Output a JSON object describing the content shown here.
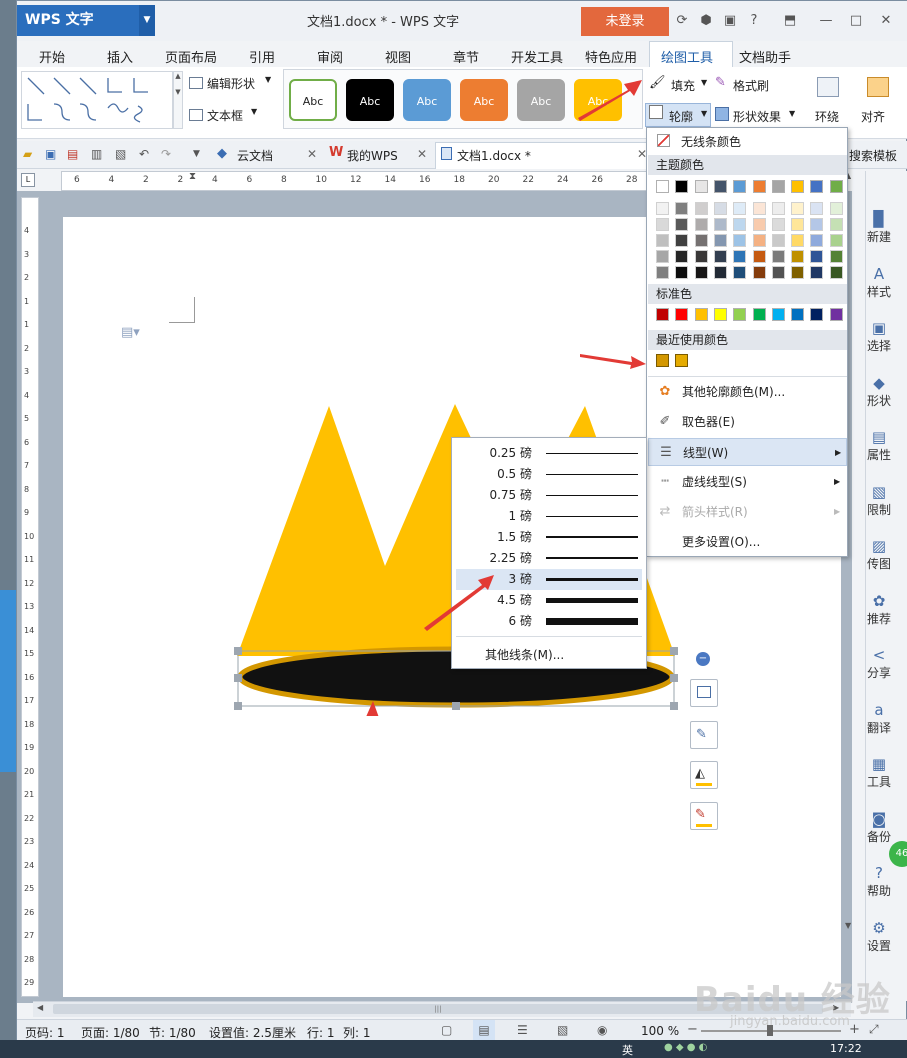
{
  "app": {
    "logo": "WPS 文字",
    "title": "文档1.docx * - WPS 文字",
    "login": "未登录"
  },
  "menu": [
    "开始",
    "插入",
    "页面布局",
    "引用",
    "审阅",
    "视图",
    "章节",
    "开发工具",
    "特色应用",
    "绘图工具",
    "文档助手"
  ],
  "ribbon": {
    "edit_shape": "编辑形状",
    "textbox": "文本框",
    "style_samples": [
      {
        "label": "Abc",
        "bg": "#ffffff",
        "border": "#70ad47",
        "color": "#222222"
      },
      {
        "label": "Abc",
        "bg": "#000000",
        "border": "#000000",
        "color": "#ffffff"
      },
      {
        "label": "Abc",
        "bg": "#5b9bd5",
        "border": "#5b9bd5",
        "color": "#ffffff"
      },
      {
        "label": "Abc",
        "bg": "#ed7d31",
        "border": "#ed7d31",
        "color": "#ffffff"
      },
      {
        "label": "Abc",
        "bg": "#a5a5a5",
        "border": "#a5a5a5",
        "color": "#ffffff"
      },
      {
        "label": "Abc",
        "bg": "#ffc000",
        "border": "#ffc000",
        "color": "#ffffff"
      }
    ],
    "fill": "填充",
    "format_painter": "格式刷",
    "outline": "轮廓",
    "shape_effects": "形状效果",
    "wrap": "环绕",
    "align": "对齐"
  },
  "tabs": {
    "cloud": "云文档",
    "mywps": "我的WPS",
    "doc": "文档1.docx *",
    "search_template": "搜索模板"
  },
  "ruler_ticks": [
    "6",
    "4",
    "2",
    "2",
    "4",
    "6",
    "8",
    "10",
    "12",
    "14",
    "16",
    "18",
    "20",
    "22",
    "24",
    "26",
    "28"
  ],
  "vruler_ticks": [
    "4",
    "3",
    "2",
    "1",
    "1",
    "2",
    "3",
    "4",
    "5",
    "6",
    "7",
    "8",
    "9",
    "10",
    "11",
    "12",
    "13",
    "14",
    "15",
    "16",
    "17",
    "18",
    "19",
    "20",
    "21",
    "22",
    "23",
    "24",
    "25",
    "26",
    "27",
    "28",
    "29"
  ],
  "outline_menu": {
    "no_line": "无线条颜色",
    "theme_colors": "主题颜色",
    "theme_top": [
      "#ffffff",
      "#000000",
      "#e7e6e6",
      "#44546a",
      "#5b9bd5",
      "#ed7d31",
      "#a5a5a5",
      "#ffc000",
      "#4472c4",
      "#70ad47"
    ],
    "theme_shades": [
      [
        "#f2f2f2",
        "#7f7f7f",
        "#d0cece",
        "#d6dce5",
        "#deebf7",
        "#fbe5d6",
        "#ededed",
        "#fff2cc",
        "#dae3f3",
        "#e2f0d9"
      ],
      [
        "#d9d9d9",
        "#595959",
        "#aeabab",
        "#adb9ca",
        "#bdd7ee",
        "#f8cbad",
        "#dbdbdb",
        "#ffe699",
        "#b4c7e7",
        "#c5e0b4"
      ],
      [
        "#bfbfbf",
        "#404040",
        "#757171",
        "#8497b0",
        "#9dc3e6",
        "#f4b183",
        "#c9c9c9",
        "#ffd966",
        "#8faadc",
        "#a9d18e"
      ],
      [
        "#a6a6a6",
        "#262626",
        "#3a3838",
        "#333f50",
        "#2e75b6",
        "#c55a11",
        "#7b7b7b",
        "#bf9000",
        "#2f5597",
        "#548235"
      ],
      [
        "#7f7f7f",
        "#0d0d0d",
        "#171616",
        "#222a35",
        "#1f4e79",
        "#843c0c",
        "#525252",
        "#7f6000",
        "#203864",
        "#385723"
      ]
    ],
    "standard_colors": "标准色",
    "standard": [
      "#c00000",
      "#ff0000",
      "#ffc000",
      "#ffff00",
      "#92d050",
      "#00b050",
      "#00b0f0",
      "#0070c0",
      "#002060",
      "#7030a0"
    ],
    "recent_colors": "最近使用颜色",
    "recent": [
      "#d39700",
      "#e5ab00"
    ],
    "more_colors": "其他轮廓颜色(M)...",
    "eyedropper": "取色器(E)",
    "line_type": "线型(W)",
    "dash_type": "虚线线型(S)",
    "arrow_style": "箭头样式(R)",
    "more_settings": "更多设置(O)..."
  },
  "weight_menu": {
    "items": [
      {
        "label": "0.25 磅",
        "weight": 0.25
      },
      {
        "label": "0.5 磅",
        "weight": 0.5
      },
      {
        "label": "0.75 磅",
        "weight": 0.75
      },
      {
        "label": "1 磅",
        "weight": 1
      },
      {
        "label": "1.5 磅",
        "weight": 1.5
      },
      {
        "label": "2.25 磅",
        "weight": 2.25
      },
      {
        "label": "3 磅",
        "weight": 3
      },
      {
        "label": "4.5 磅",
        "weight": 4.5
      },
      {
        "label": "6 磅",
        "weight": 6
      }
    ],
    "selected": "3 磅",
    "more": "其他线条(M)..."
  },
  "right_panel": [
    {
      "icon": "new-icon",
      "glyph": "▉",
      "label": "新建"
    },
    {
      "icon": "style-icon",
      "glyph": "A",
      "label": "样式"
    },
    {
      "icon": "select-icon",
      "glyph": "▣",
      "label": "选择"
    },
    {
      "icon": "shape-icon",
      "glyph": "◆",
      "label": "形状"
    },
    {
      "icon": "property-icon",
      "glyph": "▤",
      "label": "属性"
    },
    {
      "icon": "limit-icon",
      "glyph": "▧",
      "label": "限制"
    },
    {
      "icon": "image-icon",
      "glyph": "▨",
      "label": "传图"
    },
    {
      "icon": "recommend-icon",
      "glyph": "✿",
      "label": "推荐"
    },
    {
      "icon": "share-icon",
      "glyph": "<",
      "label": "分享"
    },
    {
      "icon": "translate-icon",
      "glyph": "a",
      "label": "翻译"
    },
    {
      "icon": "tools-icon",
      "glyph": "▦",
      "label": "工具"
    },
    {
      "icon": "backup-icon",
      "glyph": "◙",
      "label": "备份"
    },
    {
      "icon": "help-icon",
      "glyph": "?",
      "label": "帮助"
    },
    {
      "icon": "settings-icon",
      "glyph": "⚙",
      "label": "设置"
    }
  ],
  "float_badge": "46",
  "status": {
    "page_code": "页码: 1",
    "page": "页面: 1/80",
    "section": "节: 1/80",
    "setting": "设置值: 2.5厘米",
    "row": "行: 1",
    "col": "列: 1",
    "zoom": "100 %"
  },
  "taskbar": {
    "time": "17:22",
    "ime": "英"
  },
  "watermark": {
    "logo": "Baidu 经验",
    "url": "jingyan.baidu.com"
  },
  "colors": {
    "crown": "#ffc000",
    "crown_outline": "#d39700",
    "ellipse_fill": "#111111",
    "arrow": "#e23a35",
    "accent": "#2a6ebd"
  }
}
